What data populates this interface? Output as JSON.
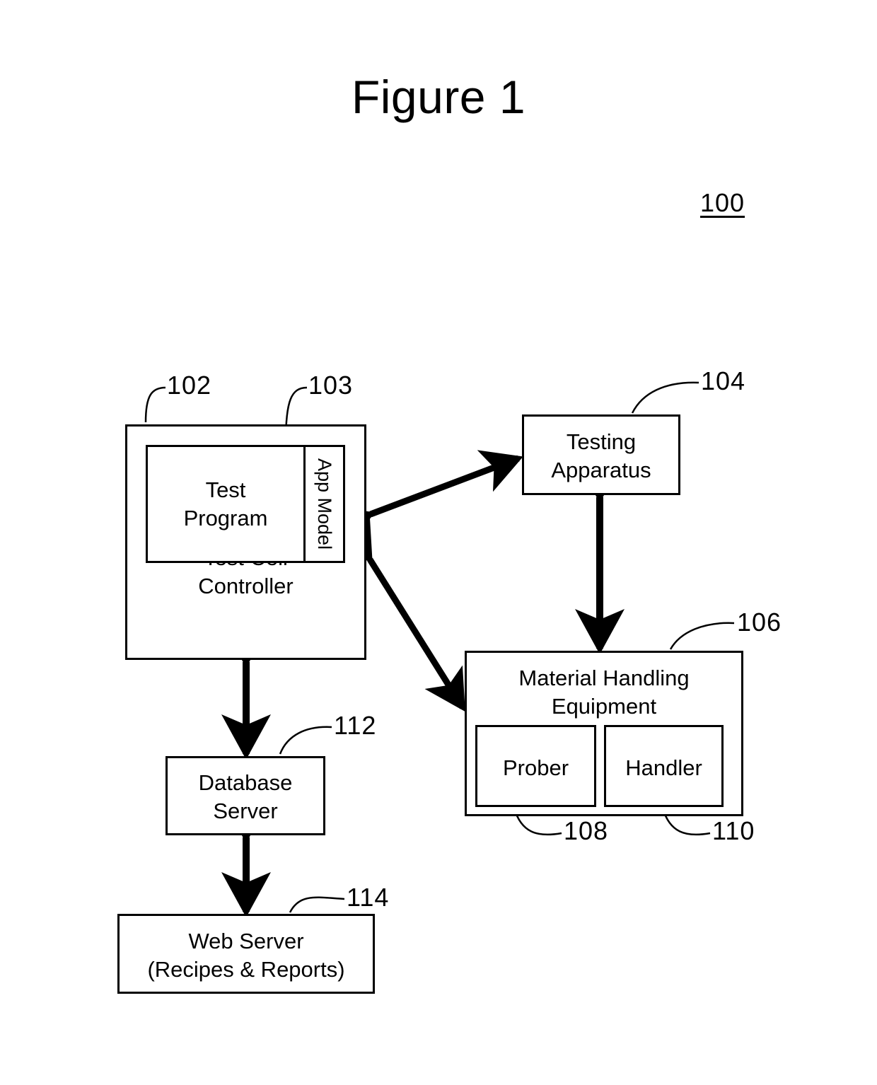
{
  "figure": {
    "title": "Figure 1",
    "system_ref": "100"
  },
  "blocks": {
    "test_cell_controller": {
      "label": "Test Cell\nController",
      "ref": "102"
    },
    "test_program": {
      "label": "Test\nProgram"
    },
    "app_model": {
      "label": "App Model",
      "ref": "103"
    },
    "testing_apparatus": {
      "label": "Testing\nApparatus",
      "ref": "104"
    },
    "material_handling_equipment": {
      "label": "Material Handling\nEquipment",
      "ref": "106"
    },
    "prober": {
      "label": "Prober",
      "ref": "108"
    },
    "handler": {
      "label": "Handler",
      "ref": "110"
    },
    "database_server": {
      "label": "Database\nServer",
      "ref": "112"
    },
    "web_server": {
      "label": "Web Server\n(Recipes & Reports)",
      "ref": "114"
    }
  },
  "connections": [
    {
      "name": "tcc-to-testing-apparatus",
      "from": "test_cell_controller",
      "to": "testing_apparatus",
      "style": "double-arrow"
    },
    {
      "name": "tcc-to-material-handling",
      "from": "test_cell_controller",
      "to": "material_handling_equipment",
      "style": "double-arrow"
    },
    {
      "name": "testing-apparatus-to-material-handling",
      "from": "testing_apparatus",
      "to": "material_handling_equipment",
      "style": "double-arrow"
    },
    {
      "name": "tcc-to-database-server",
      "from": "test_cell_controller",
      "to": "database_server",
      "style": "double-arrow"
    },
    {
      "name": "database-server-to-web-server",
      "from": "database_server",
      "to": "web_server",
      "style": "double-arrow"
    }
  ],
  "colors": {
    "stroke": "#000000",
    "background": "#ffffff"
  }
}
